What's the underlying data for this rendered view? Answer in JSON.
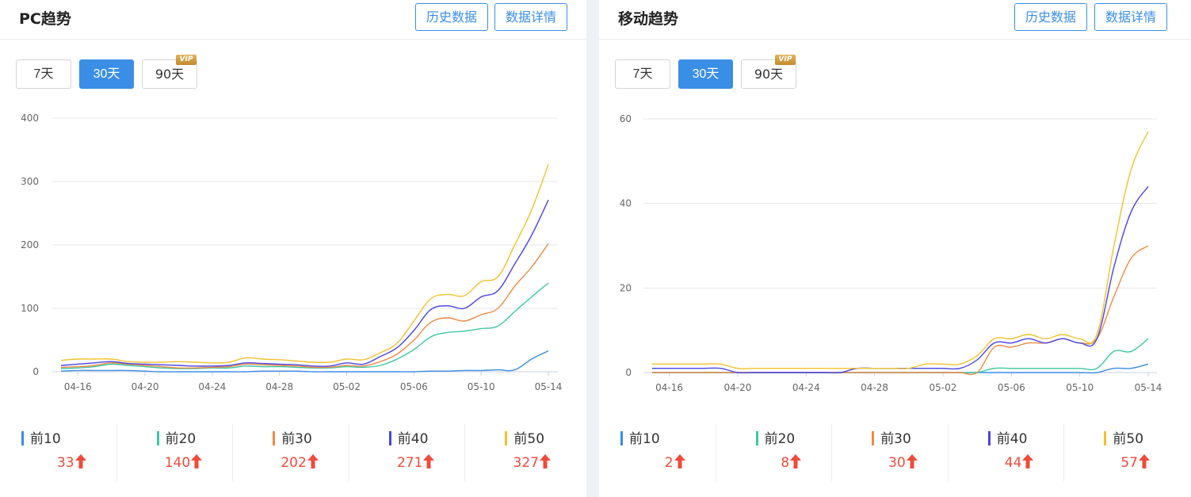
{
  "panels": [
    {
      "title": "PC趋势",
      "buttons": {
        "history": "历史数据",
        "details": "数据详情"
      },
      "ranges": [
        {
          "label": "7天",
          "active": false,
          "vip": false
        },
        {
          "label": "30天",
          "active": true,
          "vip": false
        },
        {
          "label": "90天",
          "active": false,
          "vip": true
        }
      ],
      "vip_label": "VIP",
      "legend": [
        {
          "name": "前10",
          "value": "33",
          "color": "#3b8be6"
        },
        {
          "name": "前20",
          "value": "140",
          "color": "#3dc7a3"
        },
        {
          "name": "前30",
          "value": "202",
          "color": "#ee8a46"
        },
        {
          "name": "前40",
          "value": "271",
          "color": "#4a44e0"
        },
        {
          "name": "前50",
          "value": "327",
          "color": "#f2c12e"
        }
      ]
    },
    {
      "title": "移动趋势",
      "buttons": {
        "history": "历史数据",
        "details": "数据详情"
      },
      "ranges": [
        {
          "label": "7天",
          "active": false,
          "vip": false
        },
        {
          "label": "30天",
          "active": true,
          "vip": false
        },
        {
          "label": "90天",
          "active": false,
          "vip": true
        }
      ],
      "vip_label": "VIP",
      "legend": [
        {
          "name": "前10",
          "value": "2",
          "color": "#3b8be6"
        },
        {
          "name": "前20",
          "value": "8",
          "color": "#3dc7a3"
        },
        {
          "name": "前30",
          "value": "30",
          "color": "#ee8a46"
        },
        {
          "name": "前40",
          "value": "44",
          "color": "#4a44e0"
        },
        {
          "name": "前50",
          "value": "57",
          "color": "#f2c12e"
        }
      ]
    }
  ],
  "chart_data": [
    {
      "type": "line",
      "title": "PC趋势",
      "x": [
        "04-15",
        "04-16",
        "04-17",
        "04-18",
        "04-19",
        "04-20",
        "04-21",
        "04-22",
        "04-23",
        "04-24",
        "04-25",
        "04-26",
        "04-27",
        "04-28",
        "04-29",
        "04-30",
        "05-01",
        "05-02",
        "05-03",
        "05-04",
        "05-05",
        "05-06",
        "05-07",
        "05-08",
        "05-09",
        "05-10",
        "05-11",
        "05-12",
        "05-13",
        "05-14"
      ],
      "x_tick_labels": [
        "04-16",
        "04-20",
        "04-24",
        "04-28",
        "05-02",
        "05-06",
        "05-10",
        "05-14"
      ],
      "ylim": [
        0,
        400
      ],
      "y_ticks": [
        0,
        100,
        200,
        300,
        400
      ],
      "grid": true,
      "series": [
        {
          "name": "前10",
          "color": "#3b8be6",
          "values": [
            1,
            2,
            2,
            2,
            2,
            1,
            0,
            0,
            0,
            0,
            0,
            0,
            1,
            1,
            1,
            0,
            0,
            0,
            0,
            0,
            0,
            0,
            1,
            1,
            2,
            2,
            3,
            3,
            20,
            33
          ]
        },
        {
          "name": "前20",
          "color": "#3dc7a3",
          "values": [
            5,
            6,
            8,
            12,
            10,
            8,
            6,
            5,
            5,
            6,
            6,
            9,
            8,
            8,
            7,
            6,
            6,
            8,
            7,
            10,
            20,
            35,
            55,
            62,
            64,
            68,
            72,
            95,
            118,
            140
          ]
        },
        {
          "name": "前30",
          "color": "#ee8a46",
          "values": [
            7,
            8,
            10,
            14,
            12,
            10,
            8,
            6,
            6,
            7,
            8,
            12,
            11,
            10,
            9,
            7,
            7,
            10,
            9,
            16,
            28,
            50,
            78,
            85,
            80,
            90,
            100,
            135,
            165,
            202
          ]
        },
        {
          "name": "前40",
          "color": "#4a44e0",
          "values": [
            10,
            12,
            14,
            16,
            13,
            12,
            11,
            10,
            9,
            9,
            10,
            14,
            13,
            12,
            11,
            9,
            9,
            14,
            12,
            24,
            38,
            65,
            98,
            104,
            100,
            118,
            128,
            170,
            215,
            271
          ]
        },
        {
          "name": "前50",
          "color": "#f2c12e",
          "values": [
            18,
            20,
            20,
            20,
            16,
            15,
            15,
            16,
            15,
            14,
            15,
            22,
            20,
            19,
            17,
            15,
            15,
            20,
            19,
            30,
            45,
            80,
            115,
            122,
            120,
            142,
            150,
            200,
            255,
            327
          ]
        }
      ]
    },
    {
      "type": "line",
      "title": "移动趋势",
      "x": [
        "04-15",
        "04-16",
        "04-17",
        "04-18",
        "04-19",
        "04-20",
        "04-21",
        "04-22",
        "04-23",
        "04-24",
        "04-25",
        "04-26",
        "04-27",
        "04-28",
        "04-29",
        "04-30",
        "05-01",
        "05-02",
        "05-03",
        "05-04",
        "05-05",
        "05-06",
        "05-07",
        "05-08",
        "05-09",
        "05-10",
        "05-11",
        "05-12",
        "05-13",
        "05-14"
      ],
      "x_tick_labels": [
        "04-16",
        "04-20",
        "04-24",
        "04-28",
        "05-02",
        "05-06",
        "05-10",
        "05-14"
      ],
      "ylim": [
        0,
        60
      ],
      "y_ticks": [
        0,
        20,
        40,
        60
      ],
      "grid": true,
      "series": [
        {
          "name": "前10",
          "color": "#3b8be6",
          "values": [
            0,
            0,
            0,
            0,
            0,
            0,
            0,
            0,
            0,
            0,
            0,
            0,
            0,
            0,
            0,
            0,
            0,
            0,
            0,
            0,
            0,
            0,
            0,
            0,
            0,
            0,
            0,
            1,
            1,
            2
          ]
        },
        {
          "name": "前20",
          "color": "#3dc7a3",
          "values": [
            0,
            0,
            0,
            0,
            0,
            0,
            0,
            0,
            0,
            0,
            0,
            0,
            0,
            0,
            0,
            0,
            0,
            0,
            0,
            0,
            1,
            1,
            1,
            1,
            1,
            1,
            1,
            5,
            5,
            8
          ]
        },
        {
          "name": "前30",
          "color": "#ee8a46",
          "values": [
            0,
            0,
            0,
            0,
            0,
            0,
            0,
            0,
            0,
            0,
            0,
            0,
            0,
            0,
            0,
            0,
            0,
            0,
            0,
            0,
            6,
            6,
            7,
            7,
            8,
            7,
            8,
            18,
            27,
            30
          ]
        },
        {
          "name": "前40",
          "color": "#4a44e0",
          "values": [
            1,
            1,
            1,
            1,
            1,
            0,
            0,
            0,
            0,
            0,
            0,
            0,
            1,
            1,
            1,
            1,
            1,
            1,
            1,
            3,
            7,
            7,
            8,
            7,
            8,
            7,
            8,
            25,
            38,
            44
          ]
        },
        {
          "name": "前50",
          "color": "#f2c12e",
          "values": [
            2,
            2,
            2,
            2,
            2,
            1,
            1,
            1,
            1,
            1,
            1,
            1,
            1,
            1,
            1,
            1,
            2,
            2,
            2,
            4,
            8,
            8,
            9,
            8,
            9,
            8,
            9,
            30,
            48,
            57
          ]
        }
      ]
    }
  ]
}
